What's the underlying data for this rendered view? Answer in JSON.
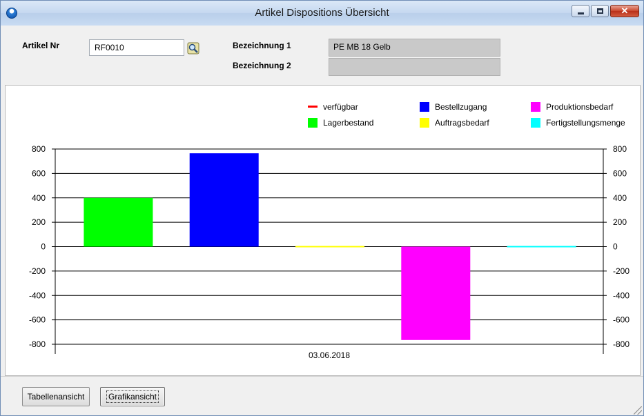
{
  "window": {
    "title": "Artikel Dispositions Übersicht",
    "icon": "app-globe-icon",
    "controls": [
      "minimize-icon",
      "maximize-icon",
      "close-icon"
    ],
    "close_glyph": "✕"
  },
  "form": {
    "artikel_nr_label": "Artikel Nr",
    "artikel_nr_value": "RF0010",
    "search_icon": "search-icon",
    "bez1_label": "Bezeichnung 1",
    "bez1_value": "PE MB 18 Gelb",
    "bez2_label": "Bezeichnung 2",
    "bez2_value": ""
  },
  "chart_data": {
    "type": "bar",
    "categories": [
      "03.06.2018"
    ],
    "x_tick_label": "03.06.2018",
    "ylim": [
      -800,
      800
    ],
    "y_ticks": [
      800,
      600,
      400,
      200,
      0,
      -200,
      -400,
      -600,
      -800
    ],
    "y_ticks_right": true,
    "grid": true,
    "legend_placement": "top-right",
    "legend": [
      {
        "name": "verfügbar",
        "color": "#ff0000",
        "marker": "line"
      },
      {
        "name": "Bestellzugang",
        "color": "#0000ff",
        "marker": "box"
      },
      {
        "name": "Produktionsbedarf",
        "color": "#ff00ff",
        "marker": "box"
      },
      {
        "name": "Lagerbestand",
        "color": "#00ff00",
        "marker": "box"
      },
      {
        "name": "Auftragsbedarf",
        "color": "#ffff00",
        "marker": "box"
      },
      {
        "name": "Fertigstellungsmenge",
        "color": "#00ffff",
        "marker": "box"
      }
    ],
    "series": [
      {
        "name": "Lagerbestand",
        "color": "#00ff00",
        "values": [
          400
        ]
      },
      {
        "name": "Bestellzugang",
        "color": "#0000ff",
        "values": [
          765
        ]
      },
      {
        "name": "Auftragsbedarf",
        "color": "#ffff00",
        "values": [
          0
        ]
      },
      {
        "name": "Produktionsbedarf",
        "color": "#ff00ff",
        "values": [
          -765
        ]
      },
      {
        "name": "Fertigstellungsmenge",
        "color": "#00ffff",
        "values": [
          0
        ]
      }
    ]
  },
  "buttons": {
    "tabellenansicht": "Tabellenansicht",
    "grafikansicht": "Grafikansicht"
  }
}
